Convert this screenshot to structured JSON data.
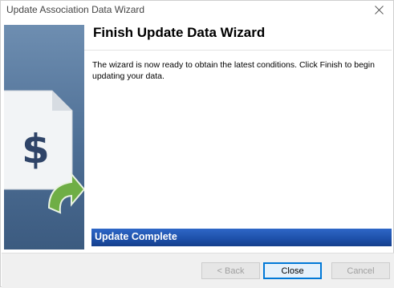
{
  "window": {
    "title": "Update Association Data Wizard"
  },
  "page": {
    "heading": "Finish Update Data Wizard",
    "description": "The wizard is now ready to obtain the latest conditions. Click Finish to begin updating your data."
  },
  "status": {
    "label": "Update Complete"
  },
  "buttons": {
    "back_label": "< Back",
    "close_label": "Close",
    "cancel_label": "Cancel"
  },
  "icons": {
    "title_close": "close-icon",
    "side_graphic": "document-dollar-arrow-icon"
  },
  "colors": {
    "side_panel": "#4d6e94",
    "status_bar": "#1d4fa8",
    "arrow_green": "#5a9a3c"
  }
}
